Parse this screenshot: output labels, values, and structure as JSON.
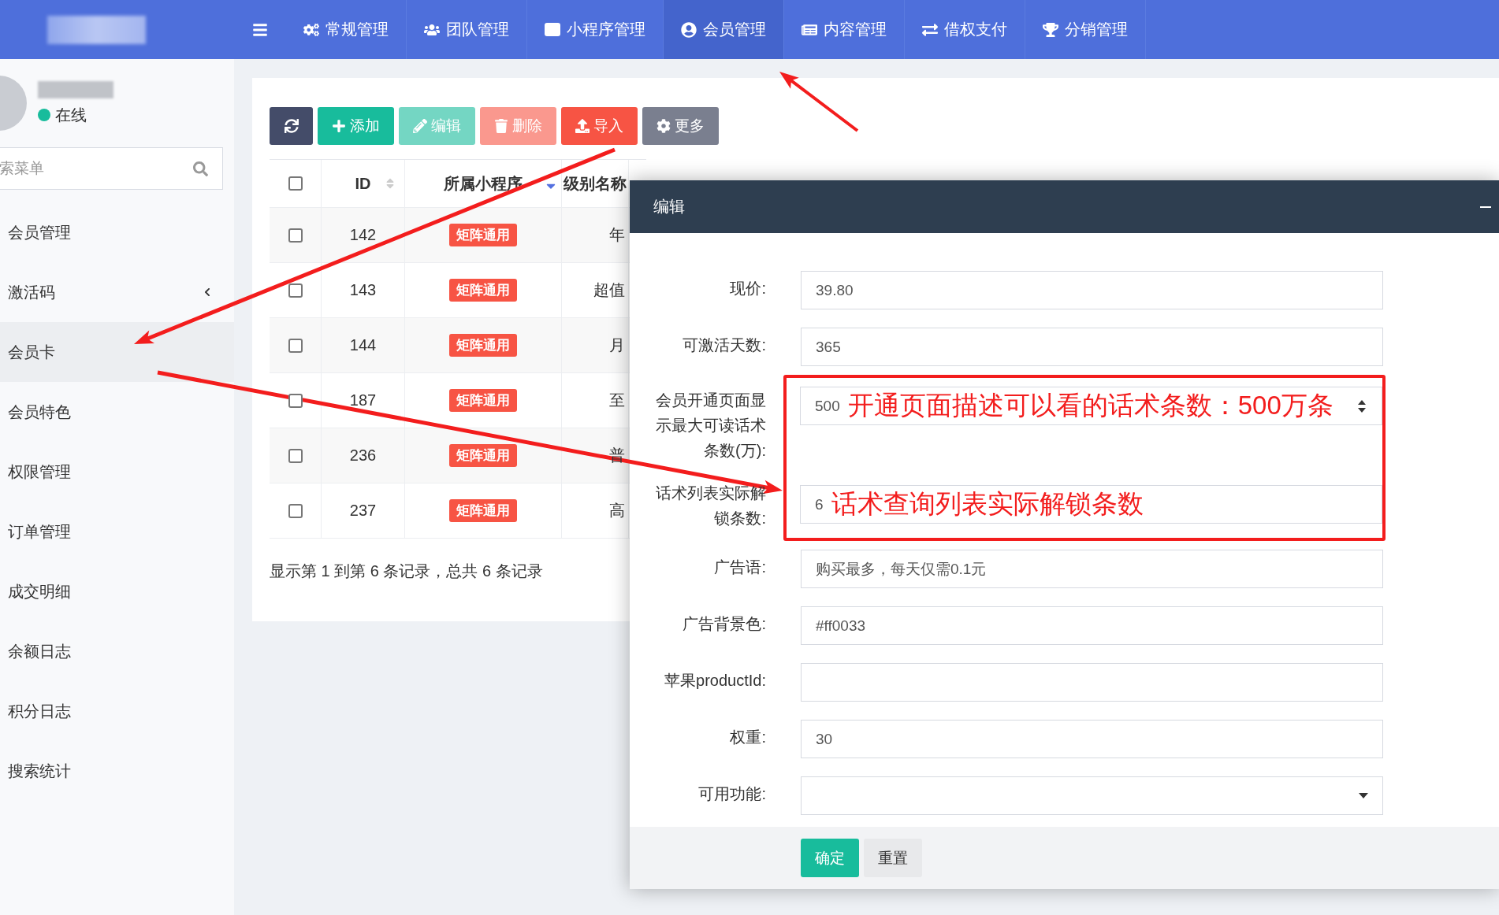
{
  "nav": {
    "items": [
      {
        "label": "常规管理",
        "selected": false
      },
      {
        "label": "团队管理",
        "selected": false
      },
      {
        "label": "小程序管理",
        "selected": false
      },
      {
        "label": "会员管理",
        "selected": true
      },
      {
        "label": "内容管理",
        "selected": false
      },
      {
        "label": "借权支付",
        "selected": false
      },
      {
        "label": "分销管理",
        "selected": false
      }
    ]
  },
  "user": {
    "status": "在线",
    "online": true
  },
  "sidebar": {
    "search_placeholder": "索菜单",
    "items": [
      {
        "label": "会员管理",
        "selected": false,
        "expandable": false
      },
      {
        "label": "激活码",
        "selected": false,
        "expandable": true
      },
      {
        "label": "会员卡",
        "selected": true,
        "expandable": false
      },
      {
        "label": "会员特色",
        "selected": false,
        "expandable": false
      },
      {
        "label": "权限管理",
        "selected": false,
        "expandable": false
      },
      {
        "label": "订单管理",
        "selected": false,
        "expandable": false
      },
      {
        "label": "成交明细",
        "selected": false,
        "expandable": false
      },
      {
        "label": "余额日志",
        "selected": false,
        "expandable": false
      },
      {
        "label": "积分日志",
        "selected": false,
        "expandable": false
      },
      {
        "label": "搜索统计",
        "selected": false,
        "expandable": false
      }
    ]
  },
  "toolbar": [
    {
      "kind": "refresh",
      "disabled": false
    },
    {
      "kind": "add",
      "label": "添加",
      "disabled": false
    },
    {
      "kind": "edit",
      "label": "编辑",
      "disabled": true
    },
    {
      "kind": "delete",
      "label": "删除",
      "disabled": true
    },
    {
      "kind": "import",
      "label": "导入",
      "disabled": false
    },
    {
      "kind": "more",
      "label": "更多",
      "disabled": false
    }
  ],
  "table": {
    "columns": [
      {
        "kind": "checkbox",
        "checked": false
      },
      {
        "kind": "sort",
        "label": "ID"
      },
      {
        "kind": "filter",
        "label": "所属小程序"
      },
      {
        "kind": "plain",
        "label": "级别名称"
      }
    ],
    "rows": [
      {
        "checked": false,
        "id": "142",
        "app": "矩阵通用",
        "level": "年"
      },
      {
        "checked": false,
        "id": "143",
        "app": "矩阵通用",
        "level": "超值"
      },
      {
        "checked": false,
        "id": "144",
        "app": "矩阵通用",
        "level": "月"
      },
      {
        "checked": false,
        "id": "187",
        "app": "矩阵通用",
        "level": "至"
      },
      {
        "checked": false,
        "id": "236",
        "app": "矩阵通用",
        "level": "普"
      },
      {
        "checked": false,
        "id": "237",
        "app": "矩阵通用",
        "level": "高"
      }
    ],
    "footer": "显示第 1 到第 6 条记录，总共 6 条记录"
  },
  "dialog": {
    "title": "编辑",
    "fields": [
      {
        "kind": "text",
        "label": "现价:",
        "value": "39.80"
      },
      {
        "kind": "text",
        "label": "可激活天数:",
        "value": "365"
      },
      {
        "kind": "number",
        "label": "会员开通页面显示最大可读话术条数(万):",
        "value": "500",
        "annotation": "开通页面描述可以看的话术条数：500万条",
        "highlighted": true
      },
      {
        "kind": "text",
        "label": "话术列表实际解锁条数:",
        "value": "6",
        "annotation": "话术查询列表实际解锁条数",
        "highlighted": true
      },
      {
        "kind": "text",
        "label": "广告语:",
        "value": "购买最多，每天仅需0.1元"
      },
      {
        "kind": "text",
        "label": "广告背景色:",
        "value": "#ff0033"
      },
      {
        "kind": "text",
        "label": "苹果productId:"
      },
      {
        "kind": "text",
        "label": "权重:",
        "value": "30"
      },
      {
        "kind": "select",
        "label": "可用功能:"
      }
    ],
    "buttons": [
      {
        "kind": "primary",
        "label": "确定"
      },
      {
        "kind": "default",
        "label": "重置"
      }
    ]
  }
}
